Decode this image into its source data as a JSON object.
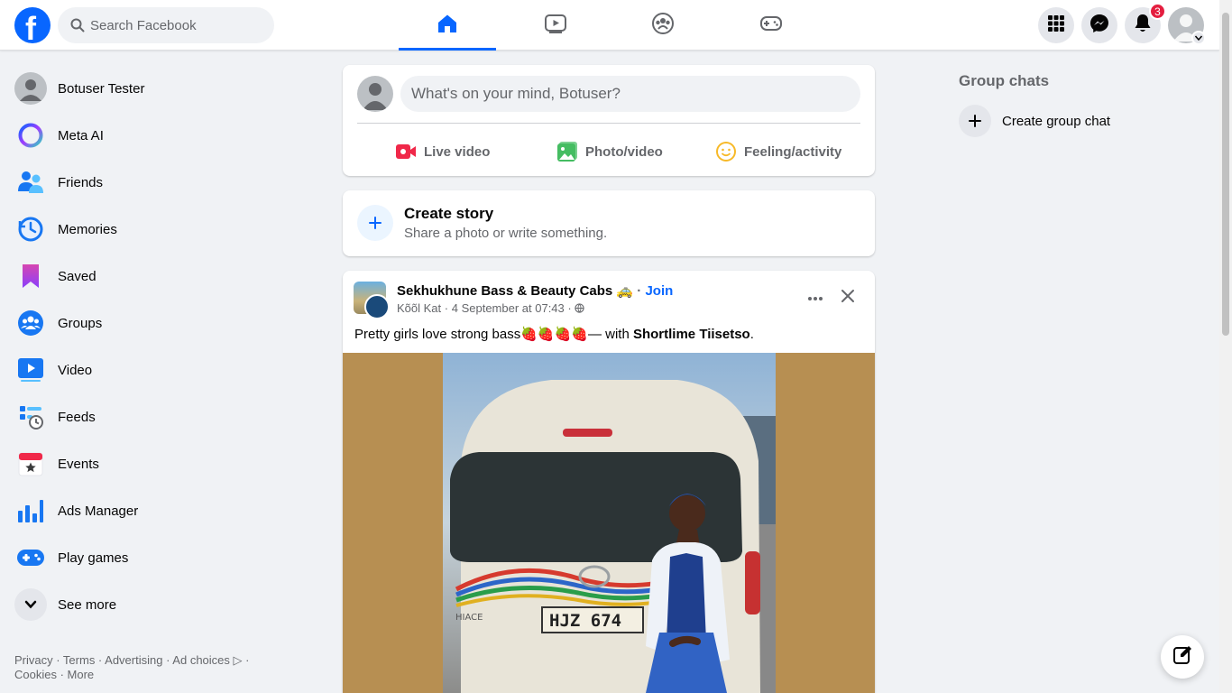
{
  "header": {
    "search_placeholder": "Search Facebook",
    "notifications_count": "3",
    "tabs": [
      "home-icon",
      "video-icon",
      "groups-icon",
      "gaming-icon"
    ],
    "active_tab": "home-icon",
    "accent": "#0866ff"
  },
  "sidebar": {
    "items": [
      {
        "label": "Botuser Tester",
        "icon": "avatar"
      },
      {
        "label": "Meta AI",
        "icon": "meta-ai-icon"
      },
      {
        "label": "Friends",
        "icon": "friends-icon"
      },
      {
        "label": "Memories",
        "icon": "memories-icon"
      },
      {
        "label": "Saved",
        "icon": "saved-icon"
      },
      {
        "label": "Groups",
        "icon": "groups-icon"
      },
      {
        "label": "Video",
        "icon": "video-icon"
      },
      {
        "label": "Feeds",
        "icon": "feeds-icon"
      },
      {
        "label": "Events",
        "icon": "events-icon"
      },
      {
        "label": "Ads Manager",
        "icon": "ads-manager-icon"
      },
      {
        "label": "Play games",
        "icon": "play-games-icon"
      },
      {
        "label": "See more",
        "icon": "chevron-down-icon"
      }
    ],
    "footer_line1": "Privacy · Terms · Advertising · Ad choices ▷ ·",
    "footer_line2": "Cookies · More"
  },
  "composer": {
    "placeholder": "What's on your mind, Botuser?",
    "live_video": "Live video",
    "photo_video": "Photo/video",
    "feeling": "Feeling/activity"
  },
  "story": {
    "title": "Create story",
    "subtitle": "Share a photo or write something."
  },
  "post": {
    "group_name": "Sekhukhune Bass & Beauty Cabs 🚕",
    "join": "Join",
    "author": "Kõõl Kat",
    "date": "4 September at 07:43",
    "caption_text": "Pretty girls love strong bass🍓🍓🍓🍓— with ",
    "caption_tag": "Shortlime Tiisetso",
    "caption_end": ".",
    "plate": "HJZ 674",
    "van_brand": "HIACE"
  },
  "right": {
    "group_chats_title": "Group chats",
    "create_group_chat": "Create group chat"
  }
}
